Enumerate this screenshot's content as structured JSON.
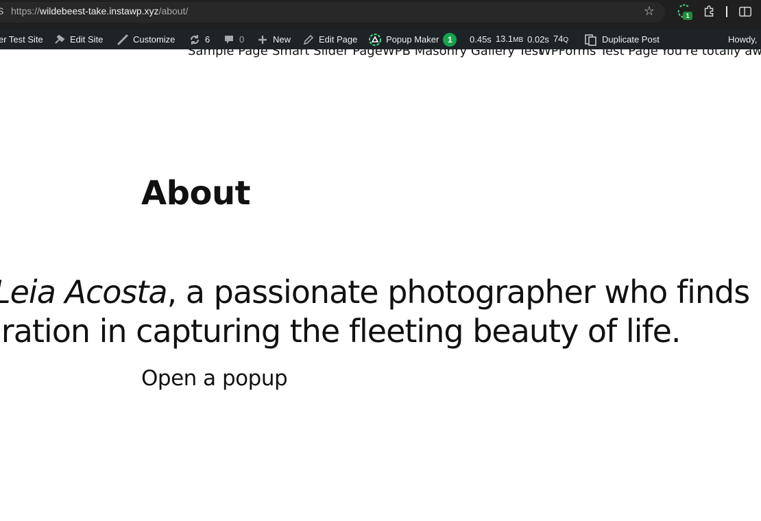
{
  "browser": {
    "url_scheme": "https://",
    "url_host": "wildebeest-take.instawp.xyz",
    "url_path": "/about/",
    "site_info_glyph": "S",
    "extension_badge": "1",
    "icons": [
      "site-info-icon",
      "bookmark-star-icon",
      "extension-icon",
      "puzzle-icon",
      "split-view-icon"
    ]
  },
  "admin_bar": {
    "site_name": "er Test Site",
    "edit_site": "Edit Site",
    "customize": "Customize",
    "updates_count": "6",
    "comments_count": "0",
    "new": "New",
    "edit_page": "Edit Page",
    "popup_maker": "Popup Maker",
    "popup_maker_badge": "1",
    "perf_time": "0.45s",
    "perf_memory": "13.1",
    "perf_memory_unit": "MB",
    "perf_query_time": "0.02s",
    "perf_queries": "74",
    "perf_queries_unit": "Q",
    "duplicate_post": "Duplicate Post",
    "howdy": "Howdy,",
    "colors": {
      "bar_bg": "#1d2327",
      "text": "#f0f0f1",
      "icon": "#a7aaad",
      "badge": "#16a34a"
    }
  },
  "nav": {
    "items": [
      "Sample Page",
      "Smart Slider Page",
      "WPB Masonry Gallery Test",
      "WPForms Test Page",
      "You're totally awes"
    ]
  },
  "page": {
    "title": "About",
    "intro_name": "Leia Acosta",
    "intro_line1_rest": ", a passionate photographer who finds",
    "intro_line2": "iration in capturing the fleeting beauty of life.",
    "popup_link": "Open a popup"
  }
}
